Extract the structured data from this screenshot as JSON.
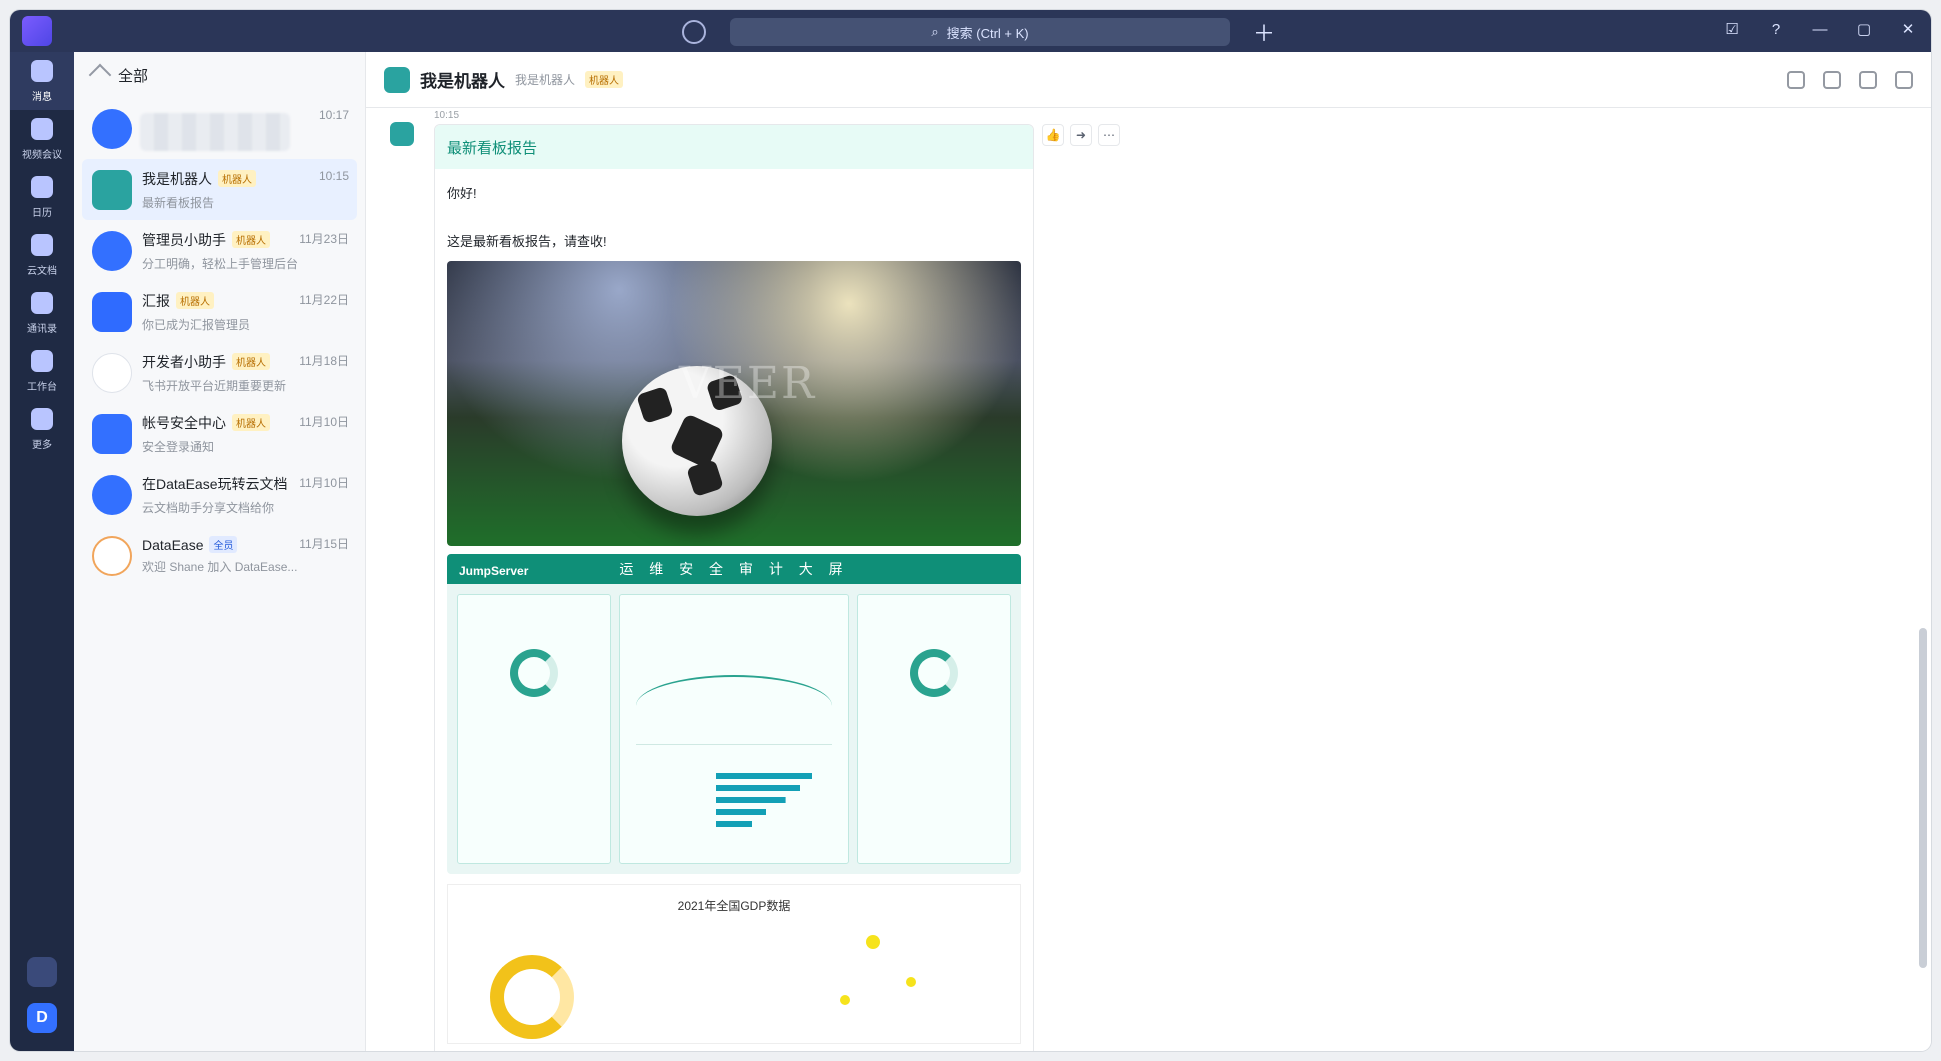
{
  "topbar": {
    "search_placeholder": "搜索 (Ctrl + K)"
  },
  "rail": {
    "items": [
      {
        "label": "消息",
        "icon": "chat-icon"
      },
      {
        "label": "视频会议",
        "icon": "video-icon"
      },
      {
        "label": "日历",
        "icon": "calendar-icon"
      },
      {
        "label": "云文档",
        "icon": "cloud-doc-icon"
      },
      {
        "label": "通讯录",
        "icon": "contacts-icon"
      },
      {
        "label": "工作台",
        "icon": "apps-icon"
      },
      {
        "label": "更多",
        "icon": "more-icon"
      }
    ],
    "profile_initial": "D"
  },
  "list": {
    "header": "全部",
    "chats": [
      {
        "name": "",
        "tag": "",
        "time": "10:17",
        "preview": ""
      },
      {
        "name": "我是机器人",
        "tag": "机器人",
        "time": "10:15",
        "preview": "最新看板报告",
        "selected": true
      },
      {
        "name": "管理员小助手",
        "tag": "机器人",
        "time": "11月23日",
        "preview": "分工明确，轻松上手管理后台"
      },
      {
        "name": "汇报",
        "tag": "机器人",
        "time": "11月22日",
        "preview": "你已成为汇报管理员"
      },
      {
        "name": "开发者小助手",
        "tag": "机器人",
        "time": "11月18日",
        "preview": "飞书开放平台近期重要更新"
      },
      {
        "name": "帐号安全中心",
        "tag": "机器人",
        "time": "11月10日",
        "preview": "安全登录通知"
      },
      {
        "name": "在DataEase玩转云文档",
        "tag": "",
        "time": "11月10日",
        "preview": "云文档助手分享文档给你"
      },
      {
        "name": "DataEase",
        "tag": "全员",
        "time": "11月15日",
        "preview": "欢迎 Shane 加入 DataEase..."
      }
    ]
  },
  "main": {
    "title": "我是机器人",
    "subtitle": "我是机器人",
    "badge": "机器人",
    "message": {
      "time": "10:15",
      "card_title": "最新看板报告",
      "lines": [
        "你好!",
        "这是最新看板报告，请查收!"
      ],
      "dashboard_title": "运 维 安 全 审 计 大 屏",
      "dashboard_brand": "JumpServer",
      "gdp_title": "2021年全国GDP数据",
      "watermark": "VEER"
    }
  }
}
